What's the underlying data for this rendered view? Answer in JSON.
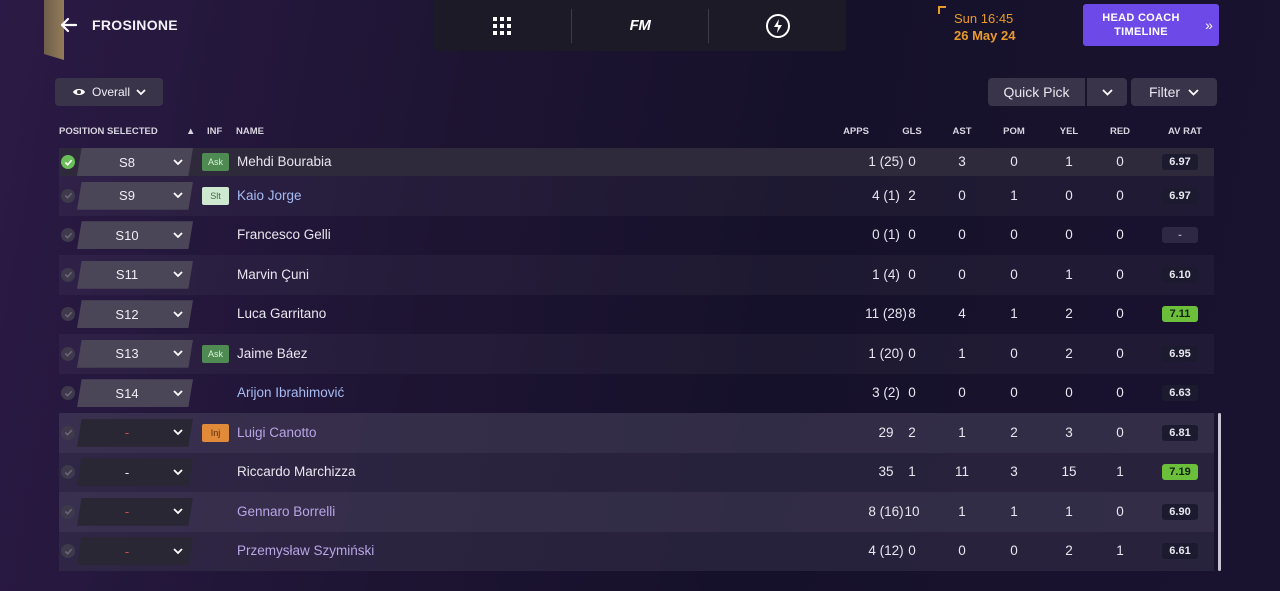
{
  "header": {
    "club_name": "FROSINONE",
    "date_time": "Sun 16:45",
    "date_day": "26 May 24",
    "head_coach_button": "HEAD COACH TIMELINE",
    "fm_logo": "FM"
  },
  "controls": {
    "view_label": "Overall",
    "quick_pick": "Quick Pick",
    "filter": "Filter"
  },
  "columns": {
    "position_selected": "POSITION SELECTED",
    "inf": "INF",
    "name": "NAME",
    "apps": "APPS",
    "gls": "GLS",
    "ast": "AST",
    "pom": "POM",
    "yel": "YEL",
    "red": "RED",
    "av_rat": "AV RAT"
  },
  "rows": [
    {
      "pos": "S8",
      "inf": "Ask",
      "name": "Mehdi Bourabia",
      "apps": "1 (25)",
      "gls": "0",
      "ast": "3",
      "pom": "0",
      "yel": "1",
      "red": "0",
      "rat": "6.97"
    },
    {
      "pos": "S9",
      "inf": "Slt",
      "name": "Kaio Jorge",
      "apps": "4 (1)",
      "gls": "2",
      "ast": "0",
      "pom": "1",
      "yel": "0",
      "red": "0",
      "rat": "6.97"
    },
    {
      "pos": "S10",
      "inf": "",
      "name": "Francesco Gelli",
      "apps": "0 (1)",
      "gls": "0",
      "ast": "0",
      "pom": "0",
      "yel": "0",
      "red": "0",
      "rat": "-"
    },
    {
      "pos": "S11",
      "inf": "",
      "name": "Marvin Çuni",
      "apps": "1 (4)",
      "gls": "0",
      "ast": "0",
      "pom": "0",
      "yel": "1",
      "red": "0",
      "rat": "6.10"
    },
    {
      "pos": "S12",
      "inf": "",
      "name": "Luca Garritano",
      "apps": "11 (28)",
      "gls": "8",
      "ast": "4",
      "pom": "1",
      "yel": "2",
      "red": "0",
      "rat": "7.11"
    },
    {
      "pos": "S13",
      "inf": "Ask",
      "name": "Jaime Báez",
      "apps": "1 (20)",
      "gls": "0",
      "ast": "1",
      "pom": "0",
      "yel": "2",
      "red": "0",
      "rat": "6.95"
    },
    {
      "pos": "S14",
      "inf": "",
      "name": "Arijon Ibrahimović",
      "apps": "3 (2)",
      "gls": "0",
      "ast": "0",
      "pom": "0",
      "yel": "0",
      "red": "0",
      "rat": "6.63"
    },
    {
      "pos": "-",
      "inf": "Inj",
      "name": "Luigi Canotto",
      "apps": "29",
      "gls": "2",
      "ast": "1",
      "pom": "2",
      "yel": "3",
      "red": "0",
      "rat": "6.81"
    },
    {
      "pos": "-",
      "inf": "",
      "name": "Riccardo Marchizza",
      "apps": "35",
      "gls": "1",
      "ast": "11",
      "pom": "3",
      "yel": "15",
      "red": "1",
      "rat": "7.19"
    },
    {
      "pos": "-",
      "inf": "",
      "name": "Gennaro Borrelli",
      "apps": "8 (16)",
      "gls": "10",
      "ast": "1",
      "pom": "1",
      "yel": "1",
      "red": "0",
      "rat": "6.90"
    },
    {
      "pos": "-",
      "inf": "",
      "name": "Przemysław Szymiński",
      "apps": "4 (12)",
      "gls": "0",
      "ast": "0",
      "pom": "0",
      "yel": "2",
      "red": "1",
      "rat": "6.61"
    }
  ],
  "colors": {
    "accent": "#6d4ae8",
    "date": "#e89a2a",
    "rating_good": "#6bbf3a",
    "ask_badge": "#4f8a53",
    "inj_badge": "#e08a3a"
  }
}
